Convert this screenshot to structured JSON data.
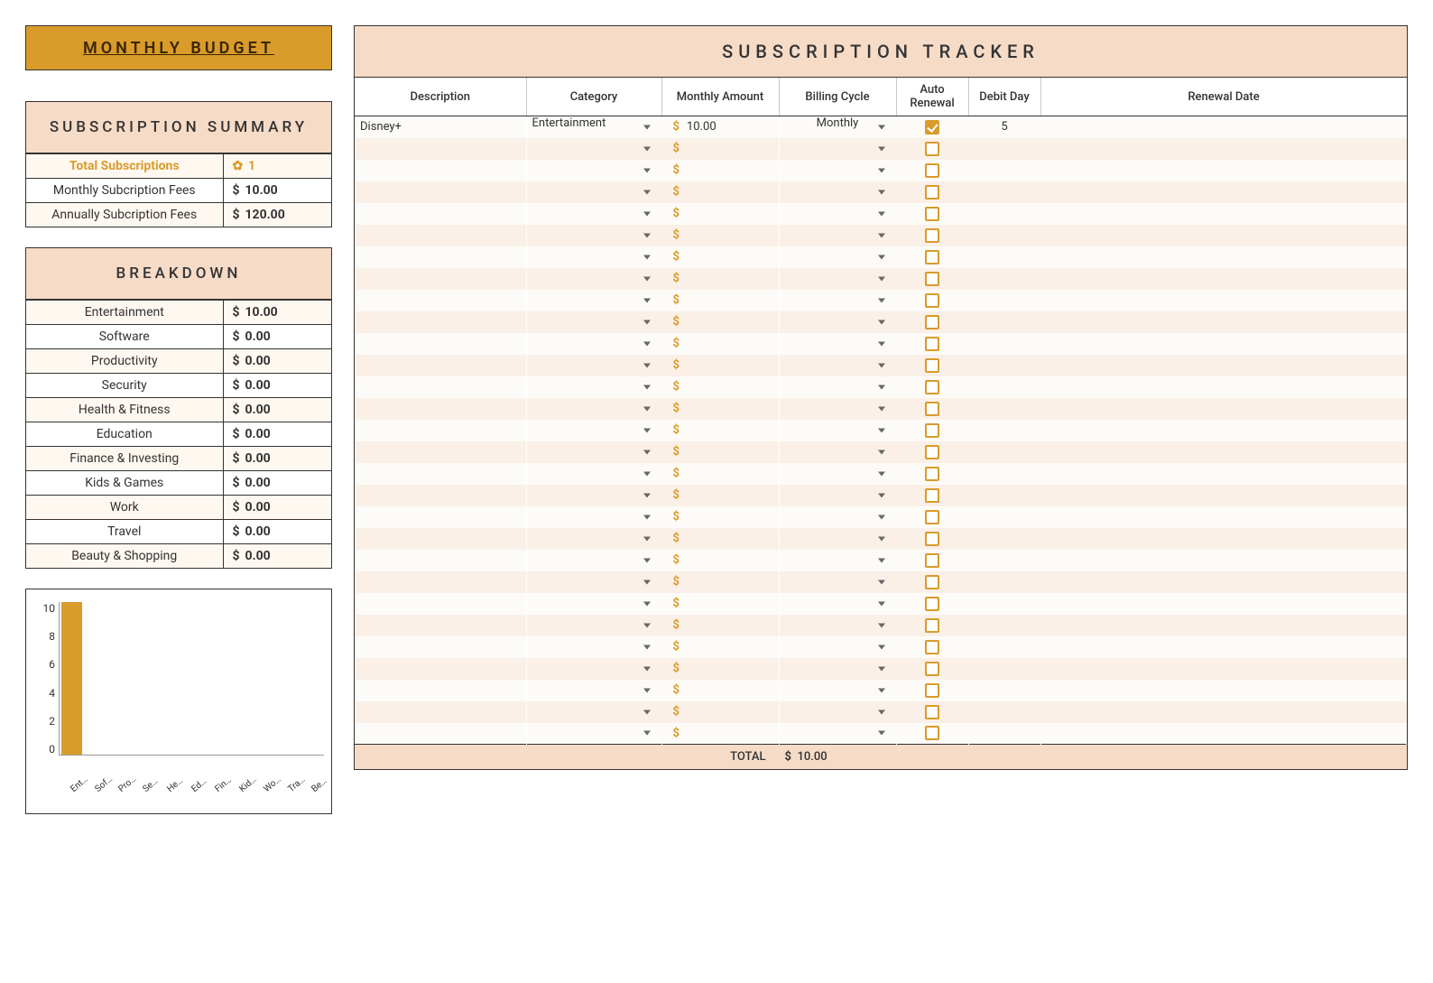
{
  "header": {
    "title": "MONTHLY BUDGET"
  },
  "summary": {
    "title": "SUBSCRIPTION SUMMARY",
    "total_label": "Total Subscriptions",
    "total_count": "1",
    "monthly_label": "Monthly Subcription Fees",
    "monthly_value": "10.00",
    "annual_label": "Annually Subcription Fees",
    "annual_value": "120.00"
  },
  "breakdown": {
    "title": "BREAKDOWN",
    "rows": [
      {
        "label": "Entertainment",
        "value": "10.00"
      },
      {
        "label": "Software",
        "value": "0.00"
      },
      {
        "label": "Productivity",
        "value": "0.00"
      },
      {
        "label": "Security",
        "value": "0.00"
      },
      {
        "label": "Health & Fitness",
        "value": "0.00"
      },
      {
        "label": "Education",
        "value": "0.00"
      },
      {
        "label": "Finance & Investing",
        "value": "0.00"
      },
      {
        "label": "Kids & Games",
        "value": "0.00"
      },
      {
        "label": "Work",
        "value": "0.00"
      },
      {
        "label": "Travel",
        "value": "0.00"
      },
      {
        "label": "Beauty & Shopping",
        "value": "0.00"
      }
    ]
  },
  "chart_data": {
    "type": "bar",
    "title": "",
    "xlabel": "",
    "ylabel": "",
    "ylim": [
      0,
      10
    ],
    "yticks": [
      0,
      2,
      4,
      6,
      8,
      10
    ],
    "categories": [
      "Entertainme…",
      "Software",
      "Productivity",
      "Security",
      "Health & Fit…",
      "Education",
      "Finance & I…",
      "Kids & Games",
      "Work",
      "Travel",
      "Beauty & S…"
    ],
    "values": [
      10,
      0,
      0,
      0,
      0,
      0,
      0,
      0,
      0,
      0,
      0
    ]
  },
  "tracker": {
    "title": "SUBSCRIPTION TRACKER",
    "columns": [
      "Description",
      "Category",
      "Monthly Amount",
      "Billing Cycle",
      "Auto Renewal",
      "Debit Day",
      "Renewal Date"
    ],
    "rows": [
      {
        "description": "Disney+",
        "category": "Entertainment",
        "amount": "10.00",
        "cycle": "Monthly",
        "auto": true,
        "debit": "5",
        "renewal": ""
      },
      {
        "description": "",
        "category": "",
        "amount": "",
        "cycle": "",
        "auto": false,
        "debit": "",
        "renewal": ""
      },
      {
        "description": "",
        "category": "",
        "amount": "",
        "cycle": "",
        "auto": false,
        "debit": "",
        "renewal": ""
      },
      {
        "description": "",
        "category": "",
        "amount": "",
        "cycle": "",
        "auto": false,
        "debit": "",
        "renewal": ""
      },
      {
        "description": "",
        "category": "",
        "amount": "",
        "cycle": "",
        "auto": false,
        "debit": "",
        "renewal": ""
      },
      {
        "description": "",
        "category": "",
        "amount": "",
        "cycle": "",
        "auto": false,
        "debit": "",
        "renewal": ""
      },
      {
        "description": "",
        "category": "",
        "amount": "",
        "cycle": "",
        "auto": false,
        "debit": "",
        "renewal": ""
      },
      {
        "description": "",
        "category": "",
        "amount": "",
        "cycle": "",
        "auto": false,
        "debit": "",
        "renewal": ""
      },
      {
        "description": "",
        "category": "",
        "amount": "",
        "cycle": "",
        "auto": false,
        "debit": "",
        "renewal": ""
      },
      {
        "description": "",
        "category": "",
        "amount": "",
        "cycle": "",
        "auto": false,
        "debit": "",
        "renewal": ""
      },
      {
        "description": "",
        "category": "",
        "amount": "",
        "cycle": "",
        "auto": false,
        "debit": "",
        "renewal": ""
      },
      {
        "description": "",
        "category": "",
        "amount": "",
        "cycle": "",
        "auto": false,
        "debit": "",
        "renewal": ""
      },
      {
        "description": "",
        "category": "",
        "amount": "",
        "cycle": "",
        "auto": false,
        "debit": "",
        "renewal": ""
      },
      {
        "description": "",
        "category": "",
        "amount": "",
        "cycle": "",
        "auto": false,
        "debit": "",
        "renewal": ""
      },
      {
        "description": "",
        "category": "",
        "amount": "",
        "cycle": "",
        "auto": false,
        "debit": "",
        "renewal": ""
      },
      {
        "description": "",
        "category": "",
        "amount": "",
        "cycle": "",
        "auto": false,
        "debit": "",
        "renewal": ""
      },
      {
        "description": "",
        "category": "",
        "amount": "",
        "cycle": "",
        "auto": false,
        "debit": "",
        "renewal": ""
      },
      {
        "description": "",
        "category": "",
        "amount": "",
        "cycle": "",
        "auto": false,
        "debit": "",
        "renewal": ""
      },
      {
        "description": "",
        "category": "",
        "amount": "",
        "cycle": "",
        "auto": false,
        "debit": "",
        "renewal": ""
      },
      {
        "description": "",
        "category": "",
        "amount": "",
        "cycle": "",
        "auto": false,
        "debit": "",
        "renewal": ""
      },
      {
        "description": "",
        "category": "",
        "amount": "",
        "cycle": "",
        "auto": false,
        "debit": "",
        "renewal": ""
      },
      {
        "description": "",
        "category": "",
        "amount": "",
        "cycle": "",
        "auto": false,
        "debit": "",
        "renewal": ""
      },
      {
        "description": "",
        "category": "",
        "amount": "",
        "cycle": "",
        "auto": false,
        "debit": "",
        "renewal": ""
      },
      {
        "description": "",
        "category": "",
        "amount": "",
        "cycle": "",
        "auto": false,
        "debit": "",
        "renewal": ""
      },
      {
        "description": "",
        "category": "",
        "amount": "",
        "cycle": "",
        "auto": false,
        "debit": "",
        "renewal": ""
      },
      {
        "description": "",
        "category": "",
        "amount": "",
        "cycle": "",
        "auto": false,
        "debit": "",
        "renewal": ""
      },
      {
        "description": "",
        "category": "",
        "amount": "",
        "cycle": "",
        "auto": false,
        "debit": "",
        "renewal": ""
      },
      {
        "description": "",
        "category": "",
        "amount": "",
        "cycle": "",
        "auto": false,
        "debit": "",
        "renewal": ""
      },
      {
        "description": "",
        "category": "",
        "amount": "",
        "cycle": "",
        "auto": false,
        "debit": "",
        "renewal": ""
      }
    ],
    "total_label": "TOTAL",
    "total_value": "10.00"
  }
}
